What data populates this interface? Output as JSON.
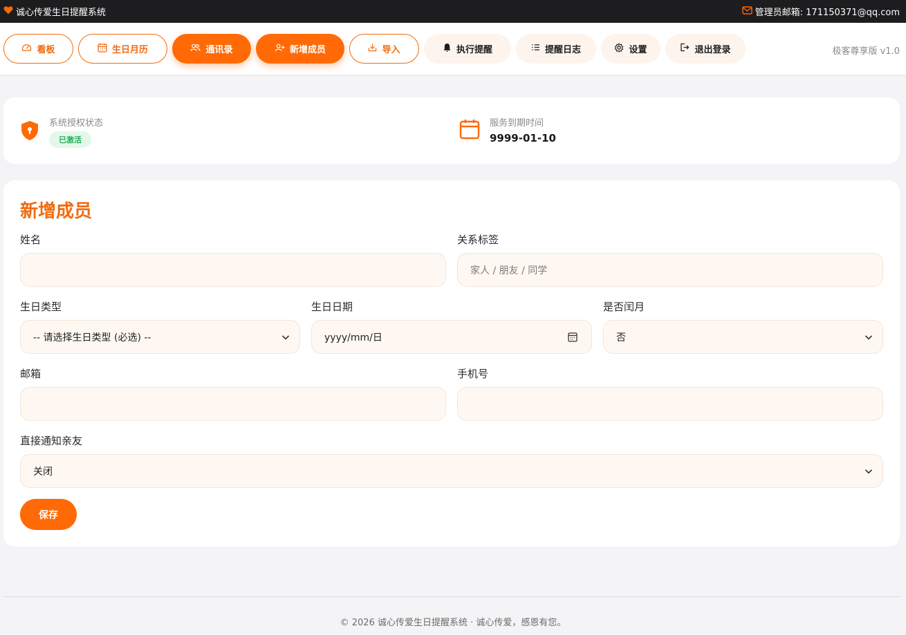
{
  "topbar": {
    "app_title": "诚心传爱生日提醒系统",
    "admin_email_label": "管理员邮箱: 171150371@qq.com"
  },
  "nav": {
    "items": [
      {
        "label": "看板",
        "icon": "dashboard-icon"
      },
      {
        "label": "生日月历",
        "icon": "calendar-icon"
      },
      {
        "label": "通讯录",
        "icon": "users-icon"
      },
      {
        "label": "新增成员",
        "icon": "user-add-icon"
      },
      {
        "label": "导入",
        "icon": "import-icon"
      },
      {
        "label": "执行提醒",
        "icon": "bell-icon"
      },
      {
        "label": "提醒日志",
        "icon": "list-icon"
      },
      {
        "label": "设置",
        "icon": "gear-icon"
      },
      {
        "label": "退出登录",
        "icon": "logout-icon"
      }
    ],
    "version": "极客尊享版 v1.0"
  },
  "status": {
    "auth_label": "系统授权状态",
    "auth_badge": "已激活",
    "expire_label": "服务到期时间",
    "expire_value": "9999-01-10"
  },
  "form": {
    "title": "新增成员",
    "name_label": "姓名",
    "name_value": "",
    "relation_label": "关系标签",
    "relation_placeholder": "家人 / 朋友 / 同学",
    "birthday_type_label": "生日类型",
    "birthday_type_value": "-- 请选择生日类型 (必选) --",
    "birthday_date_label": "生日日期",
    "birthday_date_placeholder": "yyyy/mm/日",
    "leap_label": "是否闰月",
    "leap_value": "否",
    "email_label": "邮箱",
    "email_value": "",
    "phone_label": "手机号",
    "phone_value": "",
    "notify_label": "直接通知亲友",
    "notify_value": "关闭",
    "save_label": "保存"
  },
  "footer": {
    "text": "© 2026 诚心传爱生日提醒系统 · 诚心传爱，感恩有您。"
  },
  "colors": {
    "accent": "#ff6a06",
    "accent_text": "#f26b0f",
    "topbar_bg": "#1d1d1f",
    "page_bg": "#f4f4f6",
    "field_bg": "#fff8f2",
    "success": "#1fb157"
  }
}
